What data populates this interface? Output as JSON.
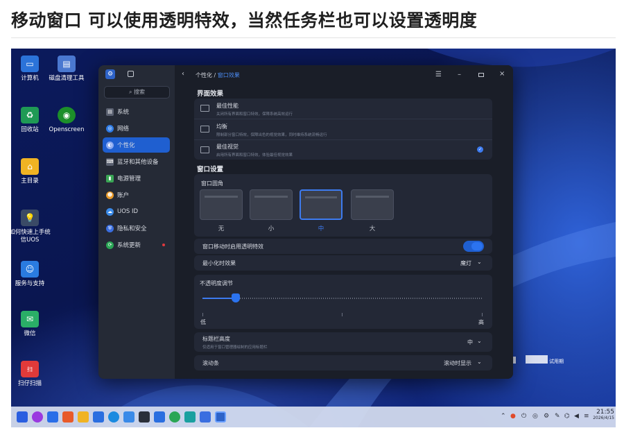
{
  "heading": "移动窗口 可以使用透明特效，当然任务栏也可以设置透明度",
  "desktop_icons": [
    {
      "label": "计算机",
      "icon": "computer-icon",
      "color": "#2b73d9"
    },
    {
      "label": "磁盘清理工具",
      "icon": "disk-cleaner-icon",
      "color": "#4a78d0"
    },
    {
      "label": "回收站",
      "icon": "trash-icon",
      "color": "#1f9a55"
    },
    {
      "label": "Openscreen",
      "icon": "openscreen-icon",
      "color": "#1c8f2a"
    },
    {
      "label": "主目录",
      "icon": "home-folder-icon",
      "color": "#f0b323"
    },
    {
      "label": "如何快速上手统信UOS",
      "icon": "help-bulb-icon",
      "color": "#3a4a66"
    },
    {
      "label": "服务与支持",
      "icon": "support-icon",
      "color": "#2a7be0"
    },
    {
      "label": "微信",
      "icon": "wechat-icon",
      "color": "#2aae67"
    },
    {
      "label": "扫仔扫描",
      "icon": "scanner-icon",
      "color": "#e03a3a"
    }
  ],
  "watermark": "试用期",
  "sidebar": {
    "search_placeholder": "搜索",
    "items": [
      {
        "label": "系统",
        "icon": "system-icon",
        "color": "#5a6070"
      },
      {
        "label": "网络",
        "icon": "network-icon",
        "color": "#2e7be6"
      },
      {
        "label": "个性化",
        "icon": "personalization-icon",
        "color": "#4a6ee0"
      },
      {
        "label": "蓝牙和其他设备",
        "icon": "bluetooth-icon",
        "color": "#5a6070"
      },
      {
        "label": "电源管理",
        "icon": "power-icon",
        "color": "#3aa655"
      },
      {
        "label": "账户",
        "icon": "account-icon",
        "color": "#e89a2a"
      },
      {
        "label": "UOS ID",
        "icon": "cloud-icon",
        "color": "#3a8ae8"
      },
      {
        "label": "隐私和安全",
        "icon": "shield-icon",
        "color": "#3a6ee0"
      },
      {
        "label": "系统更新",
        "icon": "update-icon",
        "color": "#2aa655"
      }
    ],
    "active_index": 2
  },
  "titlebar": {
    "breadcrumb_parent": "个性化",
    "breadcrumb_sep": "/",
    "breadcrumb_current": "窗口效果"
  },
  "interface_effects": {
    "title": "界面效果",
    "options": [
      {
        "title": "最佳性能",
        "desc": "关闭所有界面和窗口特效，保障系统高效运行"
      },
      {
        "title": "均衡",
        "desc": "限制部分窗口特效，保障出色的视觉效果，同时维持系统流畅运行"
      },
      {
        "title": "最佳视觉",
        "desc": "启用所有界面和窗口特效，体验最佳视觉效果"
      }
    ],
    "selected_index": 2
  },
  "window_settings": {
    "title": "窗口设置",
    "corner_label": "窗口圆角",
    "corner_options": [
      "无",
      "小",
      "中",
      "大"
    ],
    "corner_selected": 2,
    "transparent_move_label": "窗口移动时启用透明特效",
    "transparent_move_on": true,
    "minimize_label": "最小化时效果",
    "minimize_value": "魔灯"
  },
  "opacity": {
    "label": "不透明度调节",
    "low": "低",
    "high": "高",
    "level": 0.12
  },
  "titlebar_height": {
    "label": "标题栏高度",
    "desc": "仅适用于窗口管理器绘制的应用标题栏",
    "value": "中"
  },
  "scrollbar": {
    "label": "滚动条",
    "value": "滚动时显示"
  },
  "taskbar": {
    "time": "21:55",
    "date": "2026/4/15"
  },
  "colors": {
    "accent": "#1f5fd0"
  }
}
